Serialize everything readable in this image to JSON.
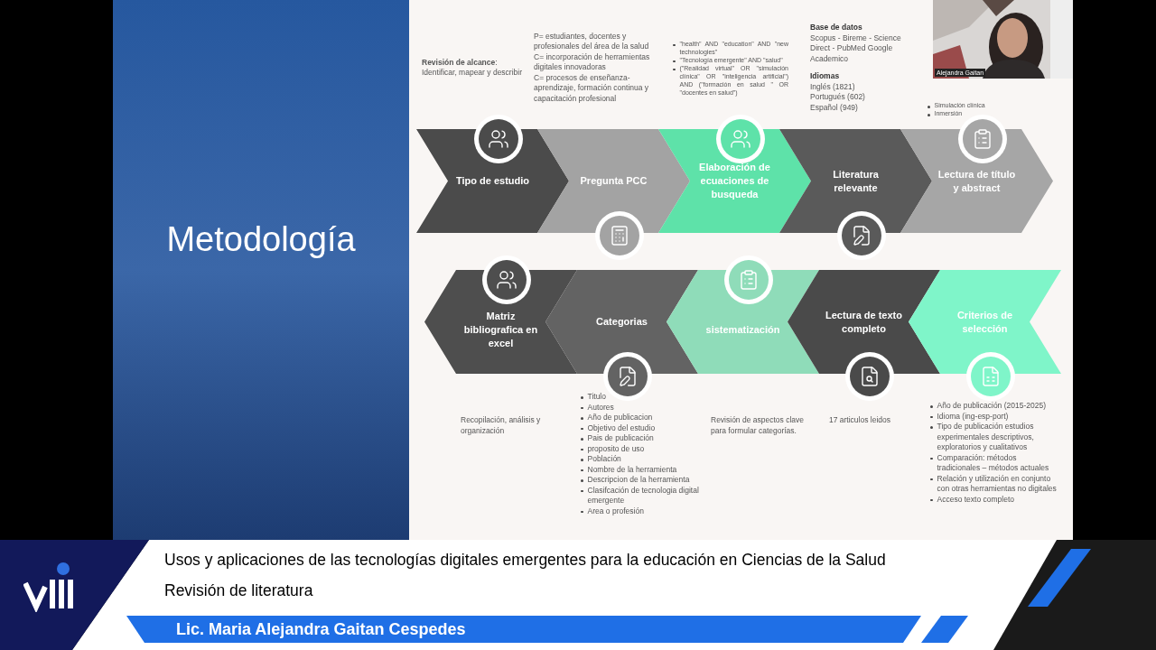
{
  "slide": {
    "title": "Metodología",
    "notes_top": [
      {
        "kind": "paragraph",
        "text": "**Revisión de alcance**: Identificar, mapear y describir"
      },
      {
        "kind": "lines",
        "lines": [
          "P= estudiantes, docentes y profesionales del área de la salud",
          "C= incorporación de herramientas digitales innovadoras",
          "C= procesos de enseñanza-aprendizaje, formación continua y capacitación profesional"
        ]
      },
      {
        "kind": "bullets",
        "items": [
          "\"health\" AND \"education\" AND \"new technologies\"",
          "\"Tecnología emergente\" AND \"salud\"",
          "(\"Realidad virtual\" OR \"simulación clínica\" OR \"inteligencia artificial\") AND (\"formación en salud \" OR \"docentes en salud\")"
        ]
      },
      {
        "kind": "sections",
        "sections": [
          {
            "heading": "Base de datos",
            "lines": [
              "Scopus - Bireme - Science Direct - PubMed Google Academico"
            ]
          },
          {
            "heading": "Idiomas",
            "lines": [
              "Inglés (1821)",
              "Portugués (602)",
              "Español (949)"
            ]
          }
        ]
      },
      {
        "kind": "bullets",
        "items": [
          "Simulación clínica",
          "Inmersión"
        ]
      }
    ],
    "flow_rows": [
      {
        "kind": "forward",
        "steps": [
          {
            "label": "Tipo de estudio",
            "color": "#4b4b4b"
          },
          {
            "label": "Pregunta PCC",
            "color": "#a3a3a3"
          },
          {
            "label": "Elaboración de ecuaciones de busqueda",
            "color": "#5ee2a9"
          },
          {
            "label": "Literatura relevante",
            "color": "#5a5a5a"
          },
          {
            "label": "Lectura de título y abstract",
            "color": "#a6a6a6"
          }
        ]
      },
      {
        "kind": "backward",
        "steps": [
          {
            "label": "Matriz bibliografica en excel",
            "color": "#4e4e4e"
          },
          {
            "label": "Categorias",
            "color": "#636363"
          },
          {
            "label": "sistematización",
            "color": "#8fdcb9"
          },
          {
            "label": "Lectura de texto completo",
            "color": "#4a4a4a"
          },
          {
            "label": "Criterios de selección",
            "color": "#7ff5c9"
          }
        ]
      }
    ],
    "notes_bottom": [
      {
        "kind": "paragraph",
        "text": "Recopilación, análisis y organización"
      },
      {
        "kind": "bullets",
        "items": [
          "Titulo",
          "Autores",
          "Año de publicacion",
          "Objetivo del estudio",
          "Pais de publicación",
          "proposito de uso",
          "Población",
          "Nombre de la herramienta",
          "Descripcion de la herramienta",
          "Clasifcación de tecnologia digital emergente",
          "Area o profesión"
        ]
      },
      {
        "kind": "paragraph",
        "text": "Revisión de aspectos clave para formular categorías."
      },
      {
        "kind": "paragraph",
        "text": "17 articulos leidos"
      },
      {
        "kind": "bullets",
        "items": [
          "Año de publicación (2015-2025)",
          "Idioma (ing-esp-port)",
          "Tipo de publicación estudios experimentales descriptivos, exploratorios y cualitativos",
          "Comparación: métodos tradicionales – métodos actuales",
          "Relación y utilización en conjunto con otras herramientas no digitales",
          "Acceso texto completo"
        ]
      }
    ]
  },
  "webcam": {
    "kind": "picture",
    "participant": "Alejandra Gaitan"
  },
  "banner": {
    "title": "Usos y aplicaciones de las tecnologías digitales emergentes para la educación en Ciencias de la Salud",
    "subtitle": "Revisión de literatura",
    "presenter": "Lic. Maria Alejandra Gaitan Cespedes"
  }
}
